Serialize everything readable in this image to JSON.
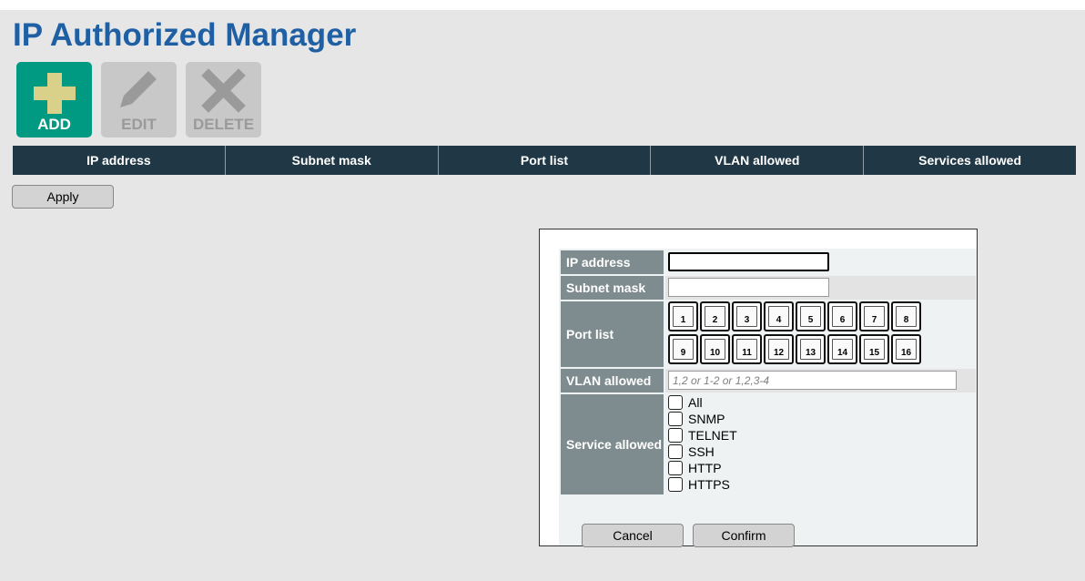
{
  "page": {
    "title": "IP Authorized Manager"
  },
  "toolbar": {
    "add_label": "ADD",
    "edit_label": "EDIT",
    "delete_label": "DELETE",
    "add_icon": "plus-icon",
    "edit_icon": "pencil-icon",
    "delete_icon": "x-icon",
    "add_color": "#009a82",
    "disabled_color": "#c8c8c8"
  },
  "table": {
    "columns": [
      "IP address",
      "Subnet mask",
      "Port list",
      "VLAN allowed",
      "Services allowed"
    ]
  },
  "apply_label": "Apply",
  "dialog": {
    "ip_label": "IP address",
    "ip_value": "",
    "mask_label": "Subnet mask",
    "mask_value": "",
    "port_label": "Port list",
    "ports": [
      "1",
      "2",
      "3",
      "4",
      "5",
      "6",
      "7",
      "8",
      "9",
      "10",
      "11",
      "12",
      "13",
      "14",
      "15",
      "16"
    ],
    "vlan_label": "VLAN allowed",
    "vlan_value": "",
    "vlan_placeholder": "1,2 or 1-2 or 1,2,3-4",
    "service_label": "Service allowed",
    "services": [
      "All",
      "SNMP",
      "TELNET",
      "SSH",
      "HTTP",
      "HTTPS"
    ],
    "cancel_label": "Cancel",
    "confirm_label": "Confirm"
  }
}
